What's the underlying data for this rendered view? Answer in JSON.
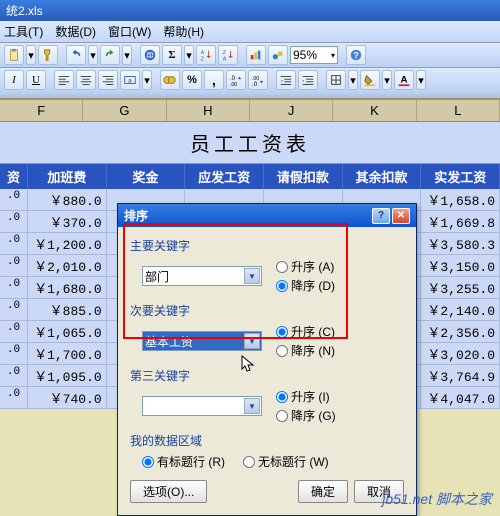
{
  "window_title": "统2.xls",
  "menus": [
    "工具(T)",
    "数据(D)",
    "窗口(W)",
    "帮助(H)"
  ],
  "zoom": "95%",
  "toolbar2_format": {
    "italic": "I",
    "under": "U"
  },
  "col_headers": [
    "F",
    "G",
    "H",
    "J",
    "K",
    "L"
  ],
  "sheet_title": "员工工资表",
  "headers": [
    "资",
    "加班费",
    "奖金",
    "应发工资",
    "请假扣款",
    "其余扣款",
    "实发工资"
  ],
  "rows": [
    [
      ".0",
      "￥880.0",
      "",
      "",
      "",
      "",
      "￥1,658.0"
    ],
    [
      ".0",
      "￥370.0",
      "",
      "",
      "",
      "",
      "￥1,669.8"
    ],
    [
      ".0",
      "￥1,200.0",
      "",
      "",
      "",
      "",
      "￥3,580.3"
    ],
    [
      ".0",
      "￥2,010.0",
      "",
      "",
      "",
      "",
      "￥3,150.0"
    ],
    [
      ".0",
      "￥1,680.0",
      "",
      "",
      "",
      "",
      "￥3,255.0"
    ],
    [
      ".0",
      "￥885.0",
      "",
      "",
      "",
      "",
      "￥2,140.0"
    ],
    [
      ".0",
      "￥1,065.0",
      "",
      "",
      "",
      "",
      "￥2,356.0"
    ],
    [
      ".0",
      "￥1,700.0",
      "",
      "",
      "",
      "",
      "￥3,020.0"
    ],
    [
      ".0",
      "￥1,095.0",
      "",
      "",
      "",
      "",
      "￥3,764.9"
    ],
    [
      ".0",
      "￥740.0",
      "",
      "",
      "",
      "",
      "￥4,047.0"
    ]
  ],
  "dialog": {
    "title": "排序",
    "primary": {
      "label": "主要关键字",
      "value": "部门",
      "asc": "升序 (A)",
      "desc": "降序 (D)",
      "sel": "desc"
    },
    "secondary": {
      "label": "次要关键字",
      "value": "基本工资",
      "asc": "升序 (C)",
      "desc": "降序 (N)",
      "sel": "asc"
    },
    "third": {
      "label": "第三关键字",
      "value": "",
      "asc": "升序 (I)",
      "desc": "降序 (G)",
      "sel": "asc"
    },
    "range_label": "我的数据区域",
    "range_header": "有标题行 (R)",
    "range_noheader": "无标题行 (W)",
    "options": "选项(O)...",
    "ok": "确定",
    "cancel": "取消"
  },
  "watermark": "jb51.net 脚本之家"
}
